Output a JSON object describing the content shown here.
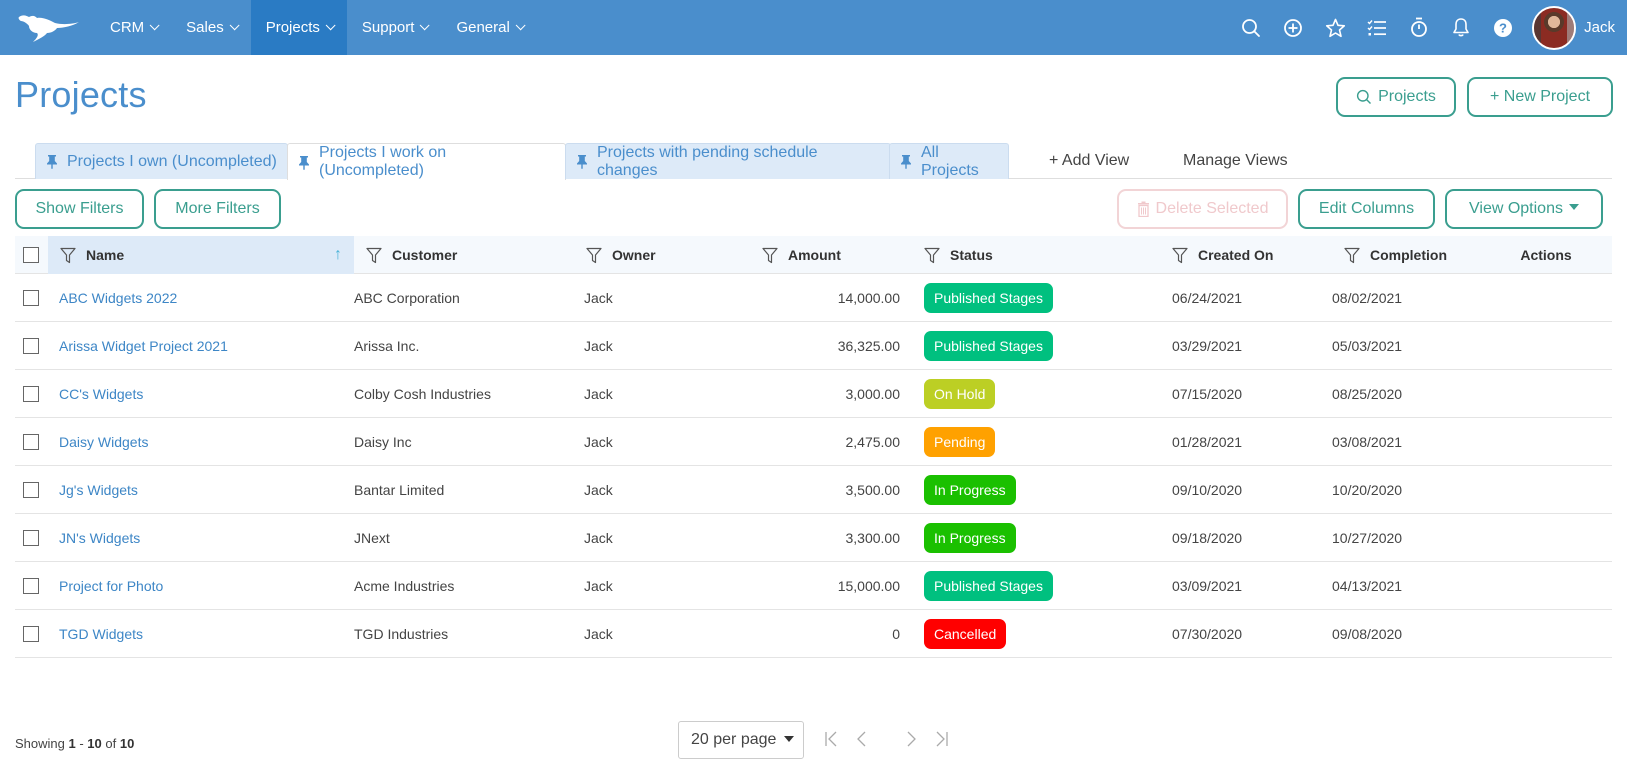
{
  "nav": {
    "items": [
      {
        "label": "CRM"
      },
      {
        "label": "Sales"
      },
      {
        "label": "Projects",
        "active": true
      },
      {
        "label": "Support"
      },
      {
        "label": "General"
      }
    ],
    "icons": [
      "search-icon",
      "add-circle-icon",
      "star-icon",
      "checklist-icon",
      "stopwatch-icon",
      "bell-icon",
      "help-icon"
    ],
    "user_name": "Jack",
    "colors": {
      "bar": "#4a8ecc",
      "active": "#2a7bc4"
    }
  },
  "page": {
    "title": "Projects",
    "search_button": "Projects",
    "new_button": "+ New Project"
  },
  "tabs": {
    "views": [
      {
        "label": "Projects I own (Uncompleted)",
        "active": false
      },
      {
        "label": "Projects I work on (Uncompleted)",
        "active": true
      },
      {
        "label": "Projects with pending schedule changes",
        "active": false
      },
      {
        "label": "All Projects",
        "active": false
      }
    ],
    "add_view": "+ Add View",
    "manage_views": "Manage Views"
  },
  "toolbar": {
    "show_filters": "Show Filters",
    "more_filters": "More Filters",
    "delete_selected": "Delete Selected",
    "edit_columns": "Edit Columns",
    "view_options": "View Options"
  },
  "table": {
    "columns": [
      "Name",
      "Customer",
      "Owner",
      "Amount",
      "Status",
      "Created On",
      "Completion",
      "Actions"
    ],
    "sorted_column": "Name",
    "sort_direction": "ascending",
    "rows": [
      {
        "name": "ABC Widgets 2022",
        "customer": "ABC Corporation",
        "owner": "Jack",
        "amount": "14,000.00",
        "status": "Published Stages",
        "status_color": "#00c07f",
        "created": "06/24/2021",
        "completion": "08/02/2021"
      },
      {
        "name": "Arissa Widget Project 2021",
        "customer": "Arissa Inc.",
        "owner": "Jack",
        "amount": "36,325.00",
        "status": "Published Stages",
        "status_color": "#00c07f",
        "created": "03/29/2021",
        "completion": "05/03/2021"
      },
      {
        "name": "CC's Widgets",
        "customer": "Colby Cosh Industries",
        "owner": "Jack",
        "amount": "3,000.00",
        "status": "On Hold",
        "status_color": "#bccf24",
        "created": "07/15/2020",
        "completion": "08/25/2020"
      },
      {
        "name": "Daisy Widgets",
        "customer": "Daisy Inc",
        "owner": "Jack",
        "amount": "2,475.00",
        "status": "Pending",
        "status_color": "#ffa100",
        "created": "01/28/2021",
        "completion": "03/08/2021"
      },
      {
        "name": "Jg's Widgets",
        "customer": "Bantar Limited",
        "owner": "Jack",
        "amount": "3,500.00",
        "status": "In Progress",
        "status_color": "#1ac000",
        "created": "09/10/2020",
        "completion": "10/20/2020"
      },
      {
        "name": "JN's Widgets",
        "customer": "JNext",
        "owner": "Jack",
        "amount": "3,300.00",
        "status": "In Progress",
        "status_color": "#1ac000",
        "created": "09/18/2020",
        "completion": "10/27/2020"
      },
      {
        "name": "Project for Photo",
        "customer": "Acme Industries",
        "owner": "Jack",
        "amount": "15,000.00",
        "status": "Published Stages",
        "status_color": "#00c07f",
        "created": "03/09/2021",
        "completion": "04/13/2021"
      },
      {
        "name": "TGD Widgets",
        "customer": "TGD Industries",
        "owner": "Jack",
        "amount": "0",
        "status": "Cancelled",
        "status_color": "#ff0000",
        "created": "07/30/2020",
        "completion": "09/08/2020"
      }
    ]
  },
  "footer": {
    "showing_prefix": "Showing",
    "range_start": "1",
    "range_sep": " - ",
    "range_end": "10",
    "of": "of",
    "total": "10",
    "per_page": "20 per page"
  },
  "theme": {
    "accent": "#3a9e8f",
    "link": "#3d86c6",
    "danger_disabled": "#f0c9cc"
  }
}
